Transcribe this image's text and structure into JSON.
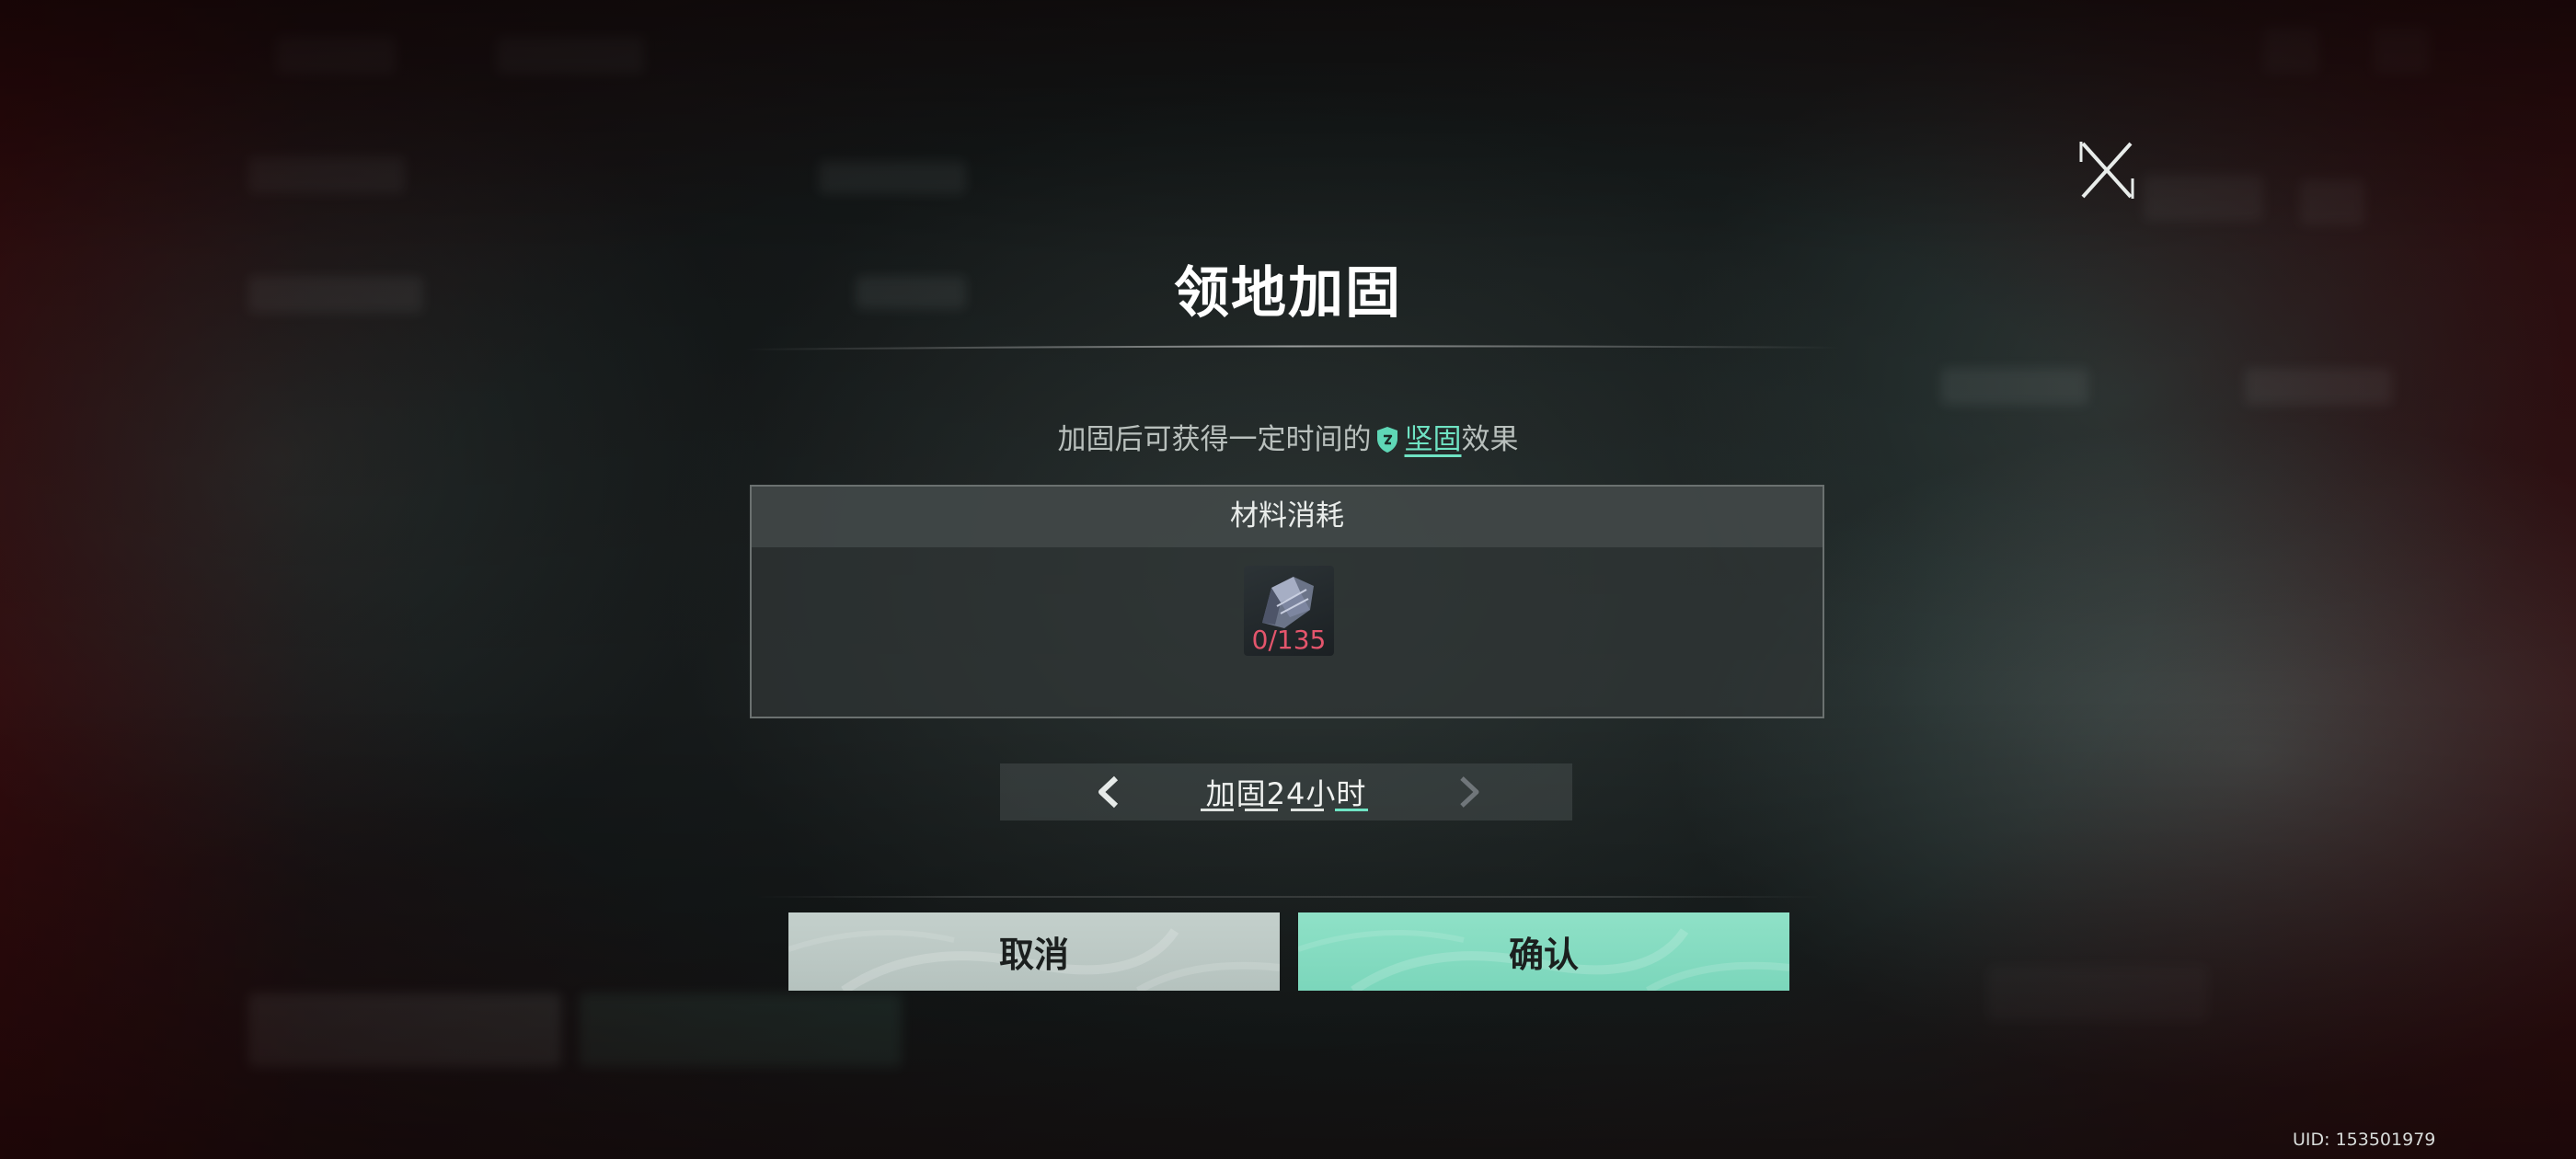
{
  "dialog": {
    "title": "领地加固",
    "description_prefix": "加固后可获得一定时间的",
    "description_link": "坚固",
    "description_suffix": "效果",
    "material_header": "材料消耗",
    "material_count": "0/135",
    "duration_label": "加固24小时",
    "cancel_label": "取消",
    "confirm_label": "确认"
  },
  "footer": {
    "uid": "UID: 153501979"
  },
  "icons": {
    "close": "close-x-icon",
    "shield": "shield-icon",
    "material": "ore-chunk-icon",
    "prev": "chevron-left-icon",
    "next": "chevron-right-icon"
  },
  "colors": {
    "accent": "#6fe3c3",
    "confirm": "#85dcc1",
    "cancel": "#bcc9c5",
    "insufficient": "#e4556c"
  }
}
